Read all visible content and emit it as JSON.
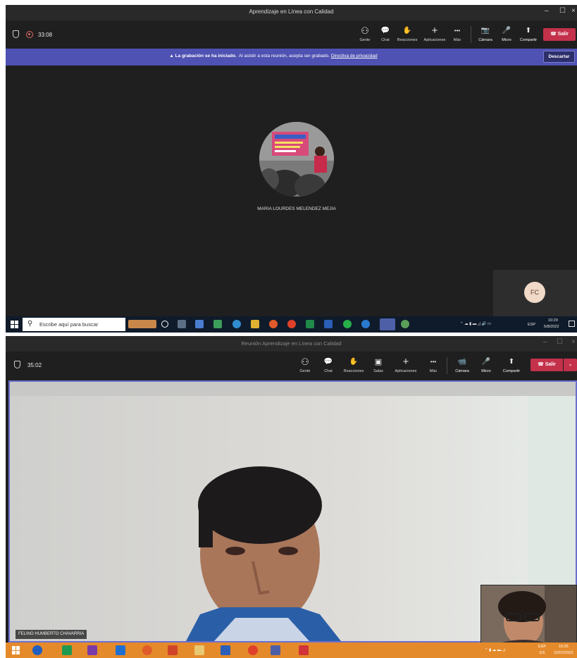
{
  "shot1": {
    "window_title": "Aprendizaje en Línea con Calidad",
    "window_controls": {
      "minimize": "–",
      "maximize": "☐",
      "close": "×"
    },
    "timer": "33:08",
    "toolbar": [
      {
        "label": "Gente",
        "icon": "people-icon",
        "glyph": "⚇"
      },
      {
        "label": "Chat",
        "icon": "chat-icon",
        "glyph": "💬"
      },
      {
        "label": "Reacciones",
        "icon": "reactions-icon",
        "glyph": "✋"
      },
      {
        "label": "Aplicaciones",
        "icon": "apps-icon",
        "glyph": "+"
      },
      {
        "label": "Más",
        "icon": "more-icon",
        "glyph": "•••"
      },
      {
        "label": "Cámara",
        "icon": "camera-off-icon",
        "glyph": "📷"
      },
      {
        "label": "Micro",
        "icon": "microphone-icon",
        "glyph": "🎤"
      },
      {
        "label": "Compartir",
        "icon": "share-icon",
        "glyph": "⬆"
      }
    ],
    "leave_label": "Salir",
    "banner": {
      "bold": "La grabación se ha iniciado.",
      "text": "Al asistir a esta reunión, acepta ser grabado.",
      "link": "Directiva de privacidad",
      "dismiss": "Descartar"
    },
    "participant_name": "MARIA LOURDES MELENDEZ MEJIA",
    "self_initials": "FC",
    "taskbar": {
      "search_placeholder": "Escribe aquí para buscar",
      "lang": "ESP",
      "time": "10:29",
      "date": "5/8/2022"
    }
  },
  "shot2": {
    "window_title": "Reunión Aprendizaje en Línea con Calidad",
    "window_controls": {
      "minimize": "–",
      "maximize": "☐",
      "close": "×"
    },
    "timer": "35:02",
    "toolbar": [
      {
        "label": "Gente",
        "icon": "people-icon",
        "glyph": "⚇"
      },
      {
        "label": "Chat",
        "icon": "chat-icon",
        "glyph": "💬"
      },
      {
        "label": "Reacciones",
        "icon": "reactions-icon",
        "glyph": "✋"
      },
      {
        "label": "Salas",
        "icon": "rooms-icon",
        "glyph": "▣"
      },
      {
        "label": "Aplicaciones",
        "icon": "apps-icon",
        "glyph": "+"
      },
      {
        "label": "Más",
        "icon": "more-icon",
        "glyph": "•••"
      },
      {
        "label": "Cámara",
        "icon": "camera-icon",
        "glyph": "📹"
      },
      {
        "label": "Micro",
        "icon": "microphone-icon",
        "glyph": "🎤"
      },
      {
        "label": "Compartir",
        "icon": "share-icon",
        "glyph": "⬆"
      }
    ],
    "leave_label": "Salir",
    "participant_name": "FELINO HUMBERTO CHAVARRIA",
    "taskbar": {
      "lang": "ESP",
      "lang_sub": "ES",
      "time": "10:25",
      "date": "22/07/2022"
    }
  },
  "colors": {
    "teams_dark": "#1f1f1f",
    "banner_purple": "#4f52b2",
    "leave_red": "#c4314b",
    "taskbar_orange": "#e58a2a",
    "frame_purple": "#6b6fcf"
  }
}
